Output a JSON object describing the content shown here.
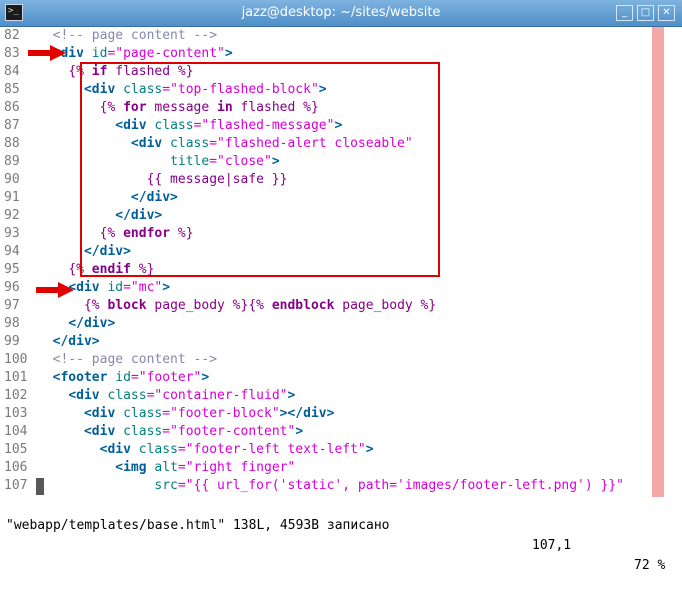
{
  "window": {
    "title": "jazz@desktop: ~/sites/website",
    "terminal_icon": ">_",
    "buttons": {
      "minimize": "_",
      "maximize": "□",
      "close": "✕"
    }
  },
  "editor": {
    "lines": [
      {
        "num": "82",
        "indent": "  ",
        "tokens": [
          {
            "t": "<!-- page content -->",
            "c": "cmt"
          }
        ]
      },
      {
        "num": "83",
        "indent": "  ",
        "tokens": [
          {
            "t": "<div",
            "c": "tag"
          },
          {
            "t": " id",
            "c": "attr"
          },
          {
            "t": "=\"page-content\"",
            "c": "str"
          },
          {
            "t": ">",
            "c": "tag"
          }
        ]
      },
      {
        "num": "84",
        "indent": "    ",
        "tokens": [
          {
            "t": "{% ",
            "c": "tpl"
          },
          {
            "t": "if",
            "c": "kw"
          },
          {
            "t": " flashed %}",
            "c": "tpl"
          }
        ]
      },
      {
        "num": "85",
        "indent": "      ",
        "tokens": [
          {
            "t": "<div",
            "c": "tag"
          },
          {
            "t": " class",
            "c": "attr"
          },
          {
            "t": "=\"top-flashed-block\"",
            "c": "str"
          },
          {
            "t": ">",
            "c": "tag"
          }
        ]
      },
      {
        "num": "86",
        "indent": "        ",
        "tokens": [
          {
            "t": "{% ",
            "c": "tpl"
          },
          {
            "t": "for",
            "c": "kw"
          },
          {
            "t": " message ",
            "c": "tpl"
          },
          {
            "t": "in",
            "c": "kw"
          },
          {
            "t": " flashed %}",
            "c": "tpl"
          }
        ]
      },
      {
        "num": "87",
        "indent": "          ",
        "tokens": [
          {
            "t": "<div",
            "c": "tag"
          },
          {
            "t": " class",
            "c": "attr"
          },
          {
            "t": "=\"flashed-message\"",
            "c": "str"
          },
          {
            "t": ">",
            "c": "tag"
          }
        ]
      },
      {
        "num": "88",
        "indent": "            ",
        "tokens": [
          {
            "t": "<div",
            "c": "tag"
          },
          {
            "t": " class",
            "c": "attr"
          },
          {
            "t": "=\"flashed-alert closeable\"",
            "c": "str"
          }
        ]
      },
      {
        "num": "89",
        "indent": "                 ",
        "tokens": [
          {
            "t": "title",
            "c": "attr"
          },
          {
            "t": "=\"close\"",
            "c": "str"
          },
          {
            "t": ">",
            "c": "tag"
          }
        ]
      },
      {
        "num": "90",
        "indent": "              ",
        "tokens": [
          {
            "t": "{{ message|safe }}",
            "c": "tpl"
          }
        ]
      },
      {
        "num": "91",
        "indent": "            ",
        "tokens": [
          {
            "t": "</div>",
            "c": "tag"
          }
        ]
      },
      {
        "num": "92",
        "indent": "          ",
        "tokens": [
          {
            "t": "</div>",
            "c": "tag"
          }
        ]
      },
      {
        "num": "93",
        "indent": "        ",
        "tokens": [
          {
            "t": "{% ",
            "c": "tpl"
          },
          {
            "t": "endfor",
            "c": "kw"
          },
          {
            "t": " %}",
            "c": "tpl"
          }
        ]
      },
      {
        "num": "94",
        "indent": "      ",
        "tokens": [
          {
            "t": "</div>",
            "c": "tag"
          }
        ]
      },
      {
        "num": "95",
        "indent": "    ",
        "tokens": [
          {
            "t": "{% ",
            "c": "tpl"
          },
          {
            "t": "endif",
            "c": "kw"
          },
          {
            "t": " %}",
            "c": "tpl"
          }
        ]
      },
      {
        "num": "96",
        "indent": "    ",
        "tokens": [
          {
            "t": "<div",
            "c": "tag"
          },
          {
            "t": " id",
            "c": "attr"
          },
          {
            "t": "=\"mc\"",
            "c": "str"
          },
          {
            "t": ">",
            "c": "tag"
          }
        ]
      },
      {
        "num": "97",
        "indent": "      ",
        "tokens": [
          {
            "t": "{% ",
            "c": "tpl"
          },
          {
            "t": "block",
            "c": "kw"
          },
          {
            "t": " page_body %}{% ",
            "c": "tpl"
          },
          {
            "t": "endblock",
            "c": "kw"
          },
          {
            "t": " page_body %}",
            "c": "tpl"
          }
        ]
      },
      {
        "num": "98",
        "indent": "    ",
        "tokens": [
          {
            "t": "</div>",
            "c": "tag"
          }
        ]
      },
      {
        "num": "99",
        "indent": "  ",
        "tokens": [
          {
            "t": "</div>",
            "c": "tag"
          }
        ]
      },
      {
        "num": "100",
        "indent": "  ",
        "tokens": [
          {
            "t": "<!-- page content -->",
            "c": "cmt"
          }
        ]
      },
      {
        "num": "101",
        "indent": "  ",
        "tokens": [
          {
            "t": "<footer",
            "c": "tag"
          },
          {
            "t": " id",
            "c": "attr"
          },
          {
            "t": "=\"footer\"",
            "c": "str"
          },
          {
            "t": ">",
            "c": "tag"
          }
        ]
      },
      {
        "num": "102",
        "indent": "    ",
        "tokens": [
          {
            "t": "<div",
            "c": "tag"
          },
          {
            "t": " class",
            "c": "attr"
          },
          {
            "t": "=\"container-fluid\"",
            "c": "str"
          },
          {
            "t": ">",
            "c": "tag"
          }
        ]
      },
      {
        "num": "103",
        "indent": "      ",
        "tokens": [
          {
            "t": "<div",
            "c": "tag"
          },
          {
            "t": " class",
            "c": "attr"
          },
          {
            "t": "=\"footer-block\"",
            "c": "str"
          },
          {
            "t": "></div>",
            "c": "tag"
          }
        ]
      },
      {
        "num": "104",
        "indent": "      ",
        "tokens": [
          {
            "t": "<div",
            "c": "tag"
          },
          {
            "t": " class",
            "c": "attr"
          },
          {
            "t": "=\"footer-content\"",
            "c": "str"
          },
          {
            "t": ">",
            "c": "tag"
          }
        ]
      },
      {
        "num": "105",
        "indent": "        ",
        "tokens": [
          {
            "t": "<div",
            "c": "tag"
          },
          {
            "t": " class",
            "c": "attr"
          },
          {
            "t": "=\"footer-left text-left\"",
            "c": "str"
          },
          {
            "t": ">",
            "c": "tag"
          }
        ]
      },
      {
        "num": "106",
        "indent": "          ",
        "tokens": [
          {
            "t": "<img",
            "c": "tag"
          },
          {
            "t": " alt",
            "c": "attr"
          },
          {
            "t": "=\"right finger\"",
            "c": "str"
          }
        ]
      },
      {
        "num": "107",
        "indent": "               ",
        "tokens": [
          {
            "t": "src",
            "c": "attr"
          },
          {
            "t": "=\"{{ url_for('static', path='images/footer-left.png') }}\"",
            "c": "str"
          }
        ]
      }
    ]
  },
  "status_bar": {
    "file_info": "\"webapp/templates/base.html\" 138L, 4593B записано",
    "cursor_pos": "107,1",
    "percent": "72 %"
  },
  "colors": {
    "highlight_box": "#e00000",
    "arrow": "#e00000",
    "guide_column": "#f4a7a7"
  }
}
